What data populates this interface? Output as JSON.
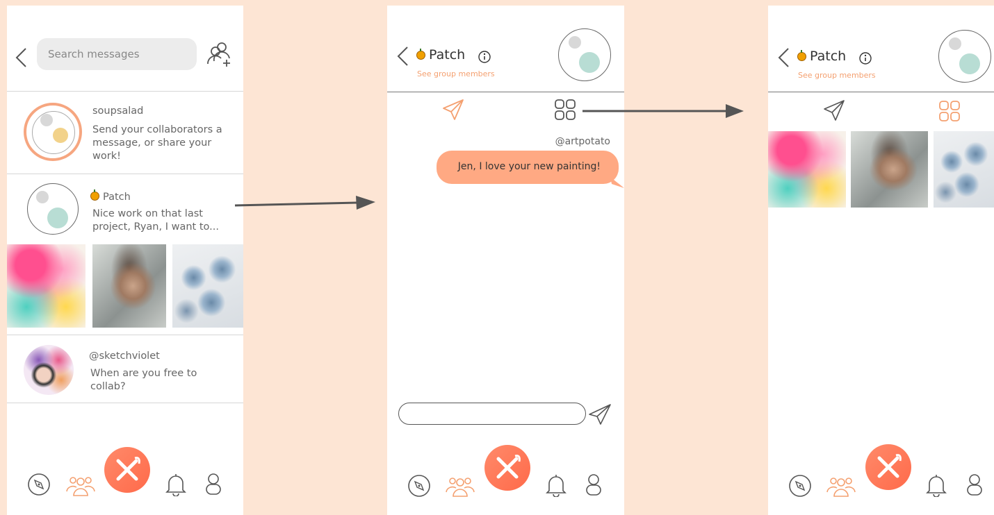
{
  "screen1": {
    "search": {
      "placeholder": "Search messages"
    },
    "conversations": [
      {
        "name": "soupsalad",
        "message": "Send your collaborators a message, or share your work!"
      },
      {
        "name": "Patch",
        "message": "Nice work on that last project, Ryan, I want to..."
      },
      {
        "name": "@sketchviolet",
        "message": "When are you free to collab?"
      }
    ]
  },
  "screen2": {
    "group_name": "Patch",
    "subtitle": "See group members",
    "sender": "@artpotato",
    "bubble_text": "Jen, I love your new painting!",
    "input_value": ""
  },
  "screen3": {
    "group_name": "Patch",
    "subtitle": "See group members"
  },
  "colors": {
    "accent": "#f4a070",
    "fab": "#ff7a5a",
    "bubble": "#ffa983",
    "background": "#fde5d4"
  },
  "icons": {
    "back": "chevron-left-icon",
    "add_user": "add-user-icon",
    "info": "info-icon",
    "send": "paper-plane-icon",
    "grid": "grid-icon",
    "explore": "compass-icon",
    "community": "group-icon",
    "create": "pencil-brush-icon",
    "notifications": "bell-icon",
    "profile": "user-icon"
  }
}
